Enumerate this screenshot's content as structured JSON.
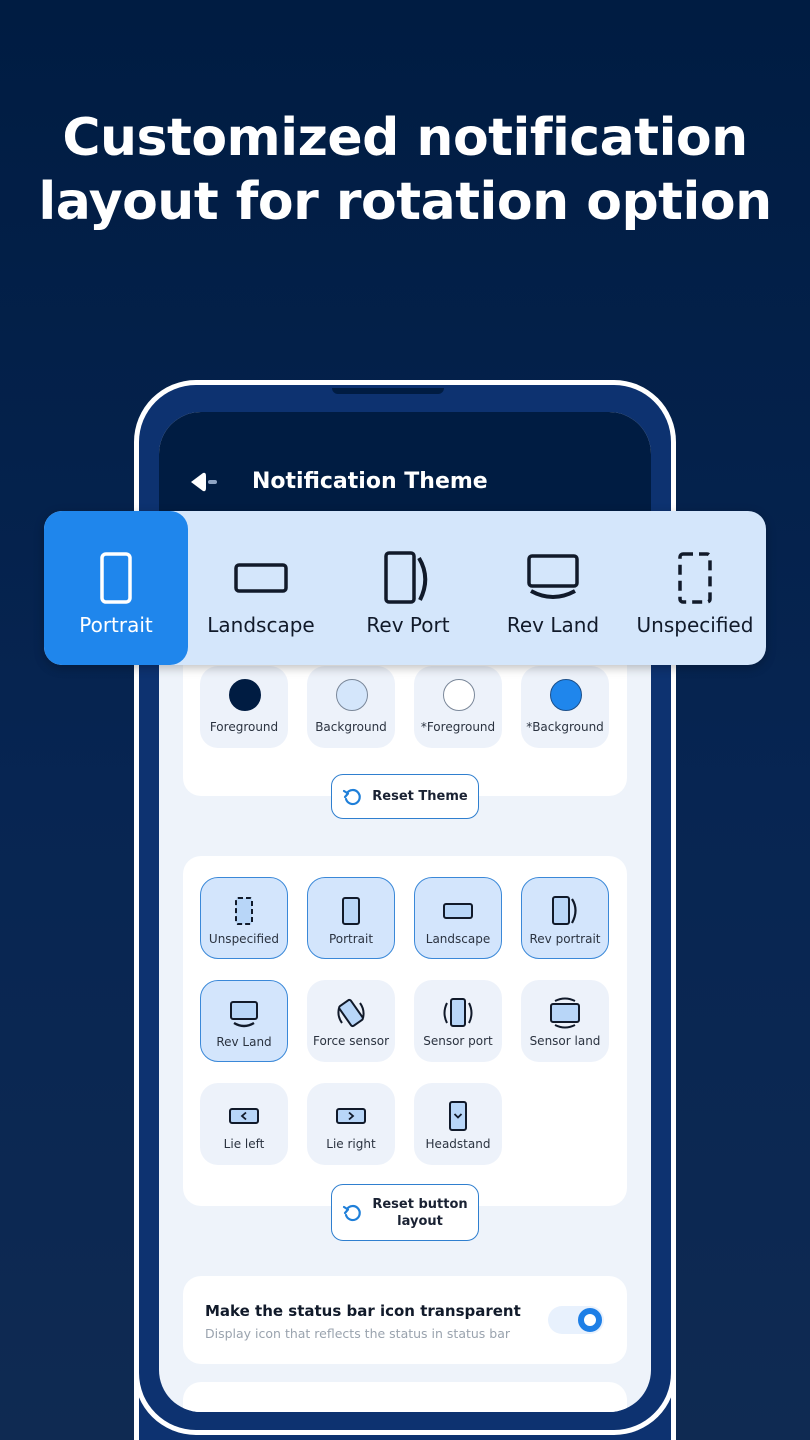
{
  "headline": {
    "line1": "Customized notification",
    "line2": "layout for rotation option"
  },
  "app_bar": {
    "title": "Notification Theme",
    "back_icon": "back-arrow-icon"
  },
  "rotation_bar": {
    "selected": "Portrait",
    "items": [
      {
        "label": "Portrait",
        "icon": "portrait-icon",
        "selected": true
      },
      {
        "label": "Landscape",
        "icon": "landscape-icon",
        "selected": false
      },
      {
        "label": "Rev Port",
        "icon": "reverse-portrait-icon",
        "selected": false
      },
      {
        "label": "Rev Land",
        "icon": "reverse-landscape-icon",
        "selected": false
      },
      {
        "label": "Unspecified",
        "icon": "unspecified-icon",
        "selected": false
      }
    ]
  },
  "theme_colors": {
    "swatches": [
      {
        "label": "Foreground",
        "color": "#001c42"
      },
      {
        "label": "Background",
        "color": "#d4e6fb"
      },
      {
        "label": "*Foreground",
        "color": "#ffffff"
      },
      {
        "label": "*Background",
        "color": "#1f86ec"
      }
    ],
    "reset_label": "Reset Theme"
  },
  "button_layout": {
    "buttons": [
      {
        "label": "Unspecified",
        "icon": "unspecified-icon",
        "active": true
      },
      {
        "label": "Portrait",
        "icon": "portrait-icon",
        "active": true
      },
      {
        "label": "Landscape",
        "icon": "landscape-icon",
        "active": true
      },
      {
        "label": "Rev portrait",
        "icon": "reverse-portrait-icon",
        "active": true
      },
      {
        "label": "Rev Land",
        "icon": "reverse-landscape-icon",
        "active": true
      },
      {
        "label": "Force sensor",
        "icon": "force-sensor-icon",
        "active": false
      },
      {
        "label": "Sensor port",
        "icon": "sensor-portrait-icon",
        "active": false
      },
      {
        "label": "Sensor land",
        "icon": "sensor-landscape-icon",
        "active": false
      },
      {
        "label": "Lie left",
        "icon": "lie-left-icon",
        "active": false
      },
      {
        "label": "Lie right",
        "icon": "lie-right-icon",
        "active": false
      },
      {
        "label": "Headstand",
        "icon": "headstand-icon",
        "active": false
      }
    ],
    "reset_label_line1": "Reset button",
    "reset_label_line2": "layout"
  },
  "status_bar_setting": {
    "title": "Make the status bar icon transparent",
    "subtitle": "Display icon that reflects the status in status bar",
    "enabled": true
  },
  "colors": {
    "accent": "#1f86ec",
    "navy": "#001c42",
    "light_blue": "#d4e6fb"
  }
}
